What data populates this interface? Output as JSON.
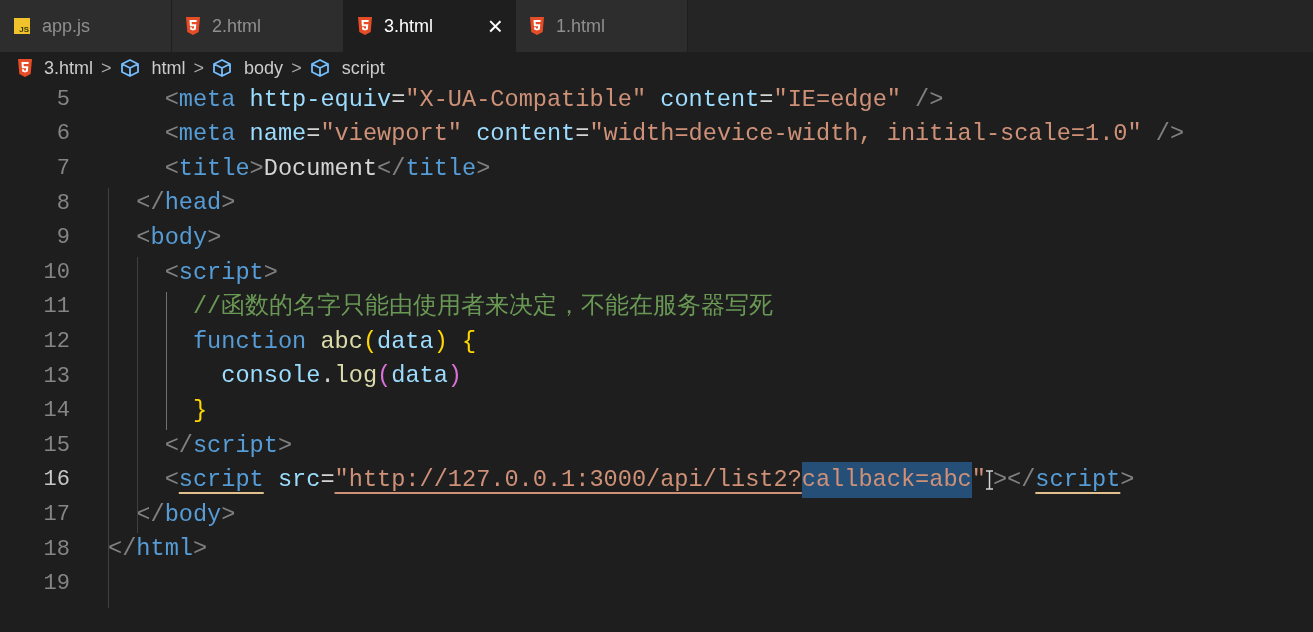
{
  "tabs": [
    {
      "label": "app.js",
      "kind": "js",
      "badge": "JS",
      "selected": false,
      "closable": false
    },
    {
      "label": "2.html",
      "kind": "html",
      "selected": false,
      "closable": false
    },
    {
      "label": "3.html",
      "kind": "html",
      "selected": true,
      "closable": true,
      "close": "×"
    },
    {
      "label": "1.html",
      "kind": "html",
      "selected": false,
      "closable": false
    }
  ],
  "breadcrumb": [
    {
      "label": "3.html",
      "kind": "html"
    },
    {
      "label": "html",
      "kind": "element"
    },
    {
      "label": "body",
      "kind": "element"
    },
    {
      "label": "script",
      "kind": "element"
    }
  ],
  "breadcrumb_separator": ">",
  "lines": [
    {
      "number": "5",
      "current": false,
      "tokens": [
        {
          "kind": "punct",
          "text": "    <"
        },
        {
          "kind": "tag",
          "text": "meta"
        },
        {
          "kind": "attr",
          "text": " http-equiv"
        },
        {
          "kind": "text",
          "text": "="
        },
        {
          "kind": "string",
          "text": "\"X-UA-Compatible\""
        },
        {
          "kind": "attr",
          "text": " content"
        },
        {
          "kind": "text",
          "text": "="
        },
        {
          "kind": "string",
          "text": "\"IE=edge\""
        },
        {
          "kind": "punct",
          "text": " />"
        }
      ]
    },
    {
      "number": "6",
      "current": false,
      "tokens": [
        {
          "kind": "punct",
          "text": "    <"
        },
        {
          "kind": "tag",
          "text": "meta"
        },
        {
          "kind": "attr",
          "text": " name"
        },
        {
          "kind": "text",
          "text": "="
        },
        {
          "kind": "string",
          "text": "\"viewport\""
        },
        {
          "kind": "attr",
          "text": " content"
        },
        {
          "kind": "text",
          "text": "="
        },
        {
          "kind": "string",
          "text": "\"width=device-width, initial-scale=1.0\""
        },
        {
          "kind": "punct",
          "text": " />"
        }
      ]
    },
    {
      "number": "7",
      "current": false,
      "tokens": [
        {
          "kind": "punct",
          "text": "    <"
        },
        {
          "kind": "tag",
          "text": "title"
        },
        {
          "kind": "punct",
          "text": ">"
        },
        {
          "kind": "text",
          "text": "Document"
        },
        {
          "kind": "punct",
          "text": "</"
        },
        {
          "kind": "tag",
          "text": "title"
        },
        {
          "kind": "punct",
          "text": ">"
        }
      ]
    },
    {
      "number": "8",
      "current": false,
      "tokens": [
        {
          "kind": "punct",
          "text": "  </"
        },
        {
          "kind": "tag",
          "text": "head"
        },
        {
          "kind": "punct",
          "text": ">"
        }
      ]
    },
    {
      "number": "9",
      "current": false,
      "tokens": [
        {
          "kind": "punct",
          "text": "  <"
        },
        {
          "kind": "tag",
          "text": "body"
        },
        {
          "kind": "punct",
          "text": ">"
        }
      ]
    },
    {
      "number": "10",
      "current": false,
      "tokens": [
        {
          "kind": "punct",
          "text": "    <"
        },
        {
          "kind": "tag",
          "text": "script"
        },
        {
          "kind": "punct",
          "text": ">"
        }
      ]
    },
    {
      "number": "11",
      "current": false,
      "tokens": [
        {
          "kind": "comment",
          "text": "      //函数的名字只能由使用者来决定，不能在服务器写死"
        }
      ]
    },
    {
      "number": "12",
      "current": false,
      "tokens": [
        {
          "kind": "keyword",
          "text": "      function"
        },
        {
          "kind": "func",
          "text": " abc"
        },
        {
          "kind": "bracket",
          "text": "("
        },
        {
          "kind": "var",
          "text": "data"
        },
        {
          "kind": "bracket",
          "text": ")"
        },
        {
          "kind": "bracket",
          "text": " {"
        }
      ]
    },
    {
      "number": "13",
      "current": false,
      "tokens": [
        {
          "kind": "var",
          "text": "        console"
        },
        {
          "kind": "text",
          "text": "."
        },
        {
          "kind": "func",
          "text": "log"
        },
        {
          "kind": "bracket2",
          "text": "("
        },
        {
          "kind": "var",
          "text": "data"
        },
        {
          "kind": "bracket2",
          "text": ")"
        }
      ]
    },
    {
      "number": "14",
      "current": false,
      "tokens": [
        {
          "kind": "bracket",
          "text": "      }"
        }
      ]
    },
    {
      "number": "15",
      "current": false,
      "tokens": [
        {
          "kind": "punct",
          "text": "    </"
        },
        {
          "kind": "tag",
          "text": "script"
        },
        {
          "kind": "punct",
          "text": ">"
        }
      ]
    },
    {
      "number": "16",
      "current": true,
      "tokens": [
        {
          "kind": "punct",
          "text": "    <"
        },
        {
          "kind": "tag-matched",
          "text": "script"
        },
        {
          "kind": "attr",
          "text": " src"
        },
        {
          "kind": "text",
          "text": "="
        },
        {
          "kind": "link",
          "text": "\"http://127.0.0.1:3000/api/list2?"
        },
        {
          "kind": "selection",
          "text": "callback=abc"
        },
        {
          "kind": "string",
          "text": "\""
        },
        {
          "kind": "cursor"
        },
        {
          "kind": "punct",
          "text": "></"
        },
        {
          "kind": "tag-matched",
          "text": "script"
        },
        {
          "kind": "punct",
          "text": ">"
        }
      ]
    },
    {
      "number": "17",
      "current": false,
      "tokens": [
        {
          "kind": "punct",
          "text": "  </"
        },
        {
          "kind": "tag",
          "text": "body"
        },
        {
          "kind": "punct",
          "text": ">"
        }
      ]
    },
    {
      "number": "18",
      "current": false,
      "tokens": [
        {
          "kind": "punct",
          "text": "</"
        },
        {
          "kind": "tag",
          "text": "html"
        },
        {
          "kind": "punct",
          "text": ">"
        }
      ]
    },
    {
      "number": "19",
      "current": false
    }
  ]
}
